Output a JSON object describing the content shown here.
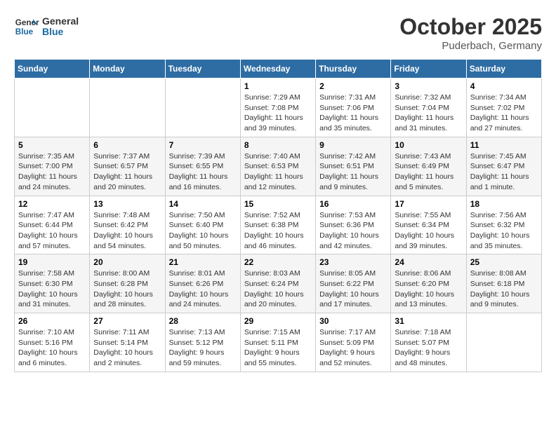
{
  "header": {
    "logo_line1": "General",
    "logo_line2": "Blue",
    "month": "October 2025",
    "location": "Puderbach, Germany"
  },
  "weekdays": [
    "Sunday",
    "Monday",
    "Tuesday",
    "Wednesday",
    "Thursday",
    "Friday",
    "Saturday"
  ],
  "weeks": [
    [
      {
        "day": "",
        "info": ""
      },
      {
        "day": "",
        "info": ""
      },
      {
        "day": "",
        "info": ""
      },
      {
        "day": "1",
        "info": "Sunrise: 7:29 AM\nSunset: 7:08 PM\nDaylight: 11 hours and 39 minutes."
      },
      {
        "day": "2",
        "info": "Sunrise: 7:31 AM\nSunset: 7:06 PM\nDaylight: 11 hours and 35 minutes."
      },
      {
        "day": "3",
        "info": "Sunrise: 7:32 AM\nSunset: 7:04 PM\nDaylight: 11 hours and 31 minutes."
      },
      {
        "day": "4",
        "info": "Sunrise: 7:34 AM\nSunset: 7:02 PM\nDaylight: 11 hours and 27 minutes."
      }
    ],
    [
      {
        "day": "5",
        "info": "Sunrise: 7:35 AM\nSunset: 7:00 PM\nDaylight: 11 hours and 24 minutes."
      },
      {
        "day": "6",
        "info": "Sunrise: 7:37 AM\nSunset: 6:57 PM\nDaylight: 11 hours and 20 minutes."
      },
      {
        "day": "7",
        "info": "Sunrise: 7:39 AM\nSunset: 6:55 PM\nDaylight: 11 hours and 16 minutes."
      },
      {
        "day": "8",
        "info": "Sunrise: 7:40 AM\nSunset: 6:53 PM\nDaylight: 11 hours and 12 minutes."
      },
      {
        "day": "9",
        "info": "Sunrise: 7:42 AM\nSunset: 6:51 PM\nDaylight: 11 hours and 9 minutes."
      },
      {
        "day": "10",
        "info": "Sunrise: 7:43 AM\nSunset: 6:49 PM\nDaylight: 11 hours and 5 minutes."
      },
      {
        "day": "11",
        "info": "Sunrise: 7:45 AM\nSunset: 6:47 PM\nDaylight: 11 hours and 1 minute."
      }
    ],
    [
      {
        "day": "12",
        "info": "Sunrise: 7:47 AM\nSunset: 6:44 PM\nDaylight: 10 hours and 57 minutes."
      },
      {
        "day": "13",
        "info": "Sunrise: 7:48 AM\nSunset: 6:42 PM\nDaylight: 10 hours and 54 minutes."
      },
      {
        "day": "14",
        "info": "Sunrise: 7:50 AM\nSunset: 6:40 PM\nDaylight: 10 hours and 50 minutes."
      },
      {
        "day": "15",
        "info": "Sunrise: 7:52 AM\nSunset: 6:38 PM\nDaylight: 10 hours and 46 minutes."
      },
      {
        "day": "16",
        "info": "Sunrise: 7:53 AM\nSunset: 6:36 PM\nDaylight: 10 hours and 42 minutes."
      },
      {
        "day": "17",
        "info": "Sunrise: 7:55 AM\nSunset: 6:34 PM\nDaylight: 10 hours and 39 minutes."
      },
      {
        "day": "18",
        "info": "Sunrise: 7:56 AM\nSunset: 6:32 PM\nDaylight: 10 hours and 35 minutes."
      }
    ],
    [
      {
        "day": "19",
        "info": "Sunrise: 7:58 AM\nSunset: 6:30 PM\nDaylight: 10 hours and 31 minutes."
      },
      {
        "day": "20",
        "info": "Sunrise: 8:00 AM\nSunset: 6:28 PM\nDaylight: 10 hours and 28 minutes."
      },
      {
        "day": "21",
        "info": "Sunrise: 8:01 AM\nSunset: 6:26 PM\nDaylight: 10 hours and 24 minutes."
      },
      {
        "day": "22",
        "info": "Sunrise: 8:03 AM\nSunset: 6:24 PM\nDaylight: 10 hours and 20 minutes."
      },
      {
        "day": "23",
        "info": "Sunrise: 8:05 AM\nSunset: 6:22 PM\nDaylight: 10 hours and 17 minutes."
      },
      {
        "day": "24",
        "info": "Sunrise: 8:06 AM\nSunset: 6:20 PM\nDaylight: 10 hours and 13 minutes."
      },
      {
        "day": "25",
        "info": "Sunrise: 8:08 AM\nSunset: 6:18 PM\nDaylight: 10 hours and 9 minutes."
      }
    ],
    [
      {
        "day": "26",
        "info": "Sunrise: 7:10 AM\nSunset: 5:16 PM\nDaylight: 10 hours and 6 minutes."
      },
      {
        "day": "27",
        "info": "Sunrise: 7:11 AM\nSunset: 5:14 PM\nDaylight: 10 hours and 2 minutes."
      },
      {
        "day": "28",
        "info": "Sunrise: 7:13 AM\nSunset: 5:12 PM\nDaylight: 9 hours and 59 minutes."
      },
      {
        "day": "29",
        "info": "Sunrise: 7:15 AM\nSunset: 5:11 PM\nDaylight: 9 hours and 55 minutes."
      },
      {
        "day": "30",
        "info": "Sunrise: 7:17 AM\nSunset: 5:09 PM\nDaylight: 9 hours and 52 minutes."
      },
      {
        "day": "31",
        "info": "Sunrise: 7:18 AM\nSunset: 5:07 PM\nDaylight: 9 hours and 48 minutes."
      },
      {
        "day": "",
        "info": ""
      }
    ]
  ]
}
